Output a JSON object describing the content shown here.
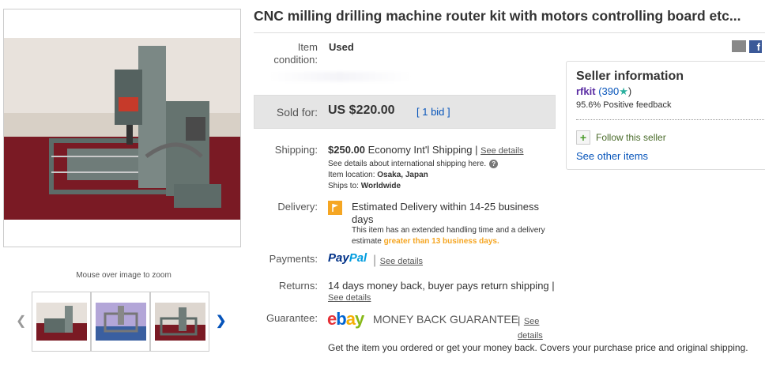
{
  "title": "CNC milling drilling machine router kit with motors controlling board etc...",
  "gallery": {
    "zoom_hint": "Mouse over image to zoom",
    "prev_icon": "chevron-left-icon",
    "next_icon": "chevron-right-icon"
  },
  "condition": {
    "label": "Item condition:",
    "value": "Used"
  },
  "sold": {
    "label": "Sold for:",
    "price": "US $220.00",
    "bids": "[ 1 bid ]"
  },
  "shipping": {
    "label": "Shipping:",
    "cost": "$250.00",
    "service": "Economy Int'l Shipping",
    "sep": "|",
    "see_details": "See details",
    "intl_note": "See details about international shipping here.",
    "location_label": "Item location:",
    "location": "Osaka, Japan",
    "ships_label": "Ships to:",
    "ships_to": "Worldwide"
  },
  "delivery": {
    "label": "Delivery:",
    "value": "Estimated Delivery within 14-25 business days",
    "note_prefix": "This item has an extended handling time and a delivery estimate",
    "note_emphasis": "greater than 13 business days."
  },
  "payments": {
    "label": "Payments:",
    "brand1": "Pay",
    "brand2": "Pal",
    "sep": "|",
    "see_details": "See details"
  },
  "returns": {
    "label": "Returns:",
    "value": "14 days money back, buyer pays return shipping |",
    "see_details": "See details"
  },
  "guarantee": {
    "label": "Guarantee:",
    "logo_e": "e",
    "logo_b": "b",
    "logo_a": "a",
    "logo_y": "y",
    "text": "MONEY BACK GUARANTEE",
    "sep": "|",
    "see_details": "See details",
    "desc": "Get the item you ordered or get your money back. Covers your purchase price and original shipping."
  },
  "seller": {
    "title": "Seller information",
    "name": "rfkit",
    "score": "(390",
    "score_close": ")",
    "feedback": "95.6% Positive feedback",
    "follow": "Follow this seller",
    "other_items": "See other items"
  },
  "colors": {
    "link": "#0654ba",
    "sold_box": "#e5e5e5",
    "accent": "#f5a623"
  }
}
